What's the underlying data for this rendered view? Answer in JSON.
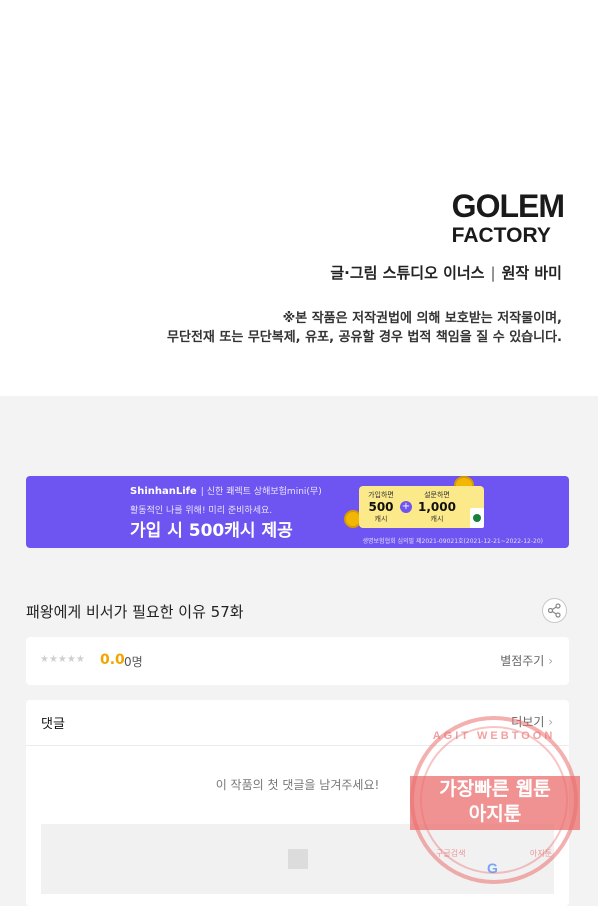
{
  "header": {
    "logo_line1": "GOLEM",
    "logo_line2": "FACTORY",
    "credit_art": "글·그림 스튜디오 이너스",
    "credit_sep": "|",
    "credit_original": "원작 바미",
    "notice_line1": "※본 작품은 저작권법에 의해 보호받는 저작물이며,",
    "notice_line2": "무단전재 또는 무단복제, 유포, 공유할 경우 법적 책임을 질 수 있습니다."
  },
  "banner": {
    "brand": "ShinhanLife",
    "brand_sub": "| 신한 쾌렉트 상해보험mini(무)",
    "sub": "활동적인 나를 위해! 미리 준비하세요.",
    "main": "가입 시 500캐시 제공",
    "coupon_left_top": "가입하면",
    "coupon_left_value": "500",
    "coupon_left_unit": "캐시",
    "coupon_plus": "+",
    "coupon_right_top": "설문하면",
    "coupon_right_value": "1,000",
    "coupon_right_unit": "캐시",
    "fine_print": "생명보험협회 심의필 제2021-09021호(2021-12-21~2022-12-20)",
    "color": "#6e54f0"
  },
  "episode": {
    "title": "패왕에게 비서가 필요한 이유 57화",
    "share_icon": "share-icon"
  },
  "rating": {
    "stars": "★★★★★",
    "score": "0.0",
    "count": "0명",
    "rate_label": "별점주기",
    "score_color": "#f0a500"
  },
  "comments": {
    "title": "댓글",
    "more_label": "더보기",
    "empty_message": "이 작품의 첫 댓글을 남겨주세요!"
  },
  "watermark": {
    "arc_text": "AGIT WEBTOON",
    "line1": "가장빠른 웹툰",
    "line2": "아지툰",
    "foot_left": "구글검색",
    "foot_right": "아지툰",
    "google_letter": "G"
  }
}
